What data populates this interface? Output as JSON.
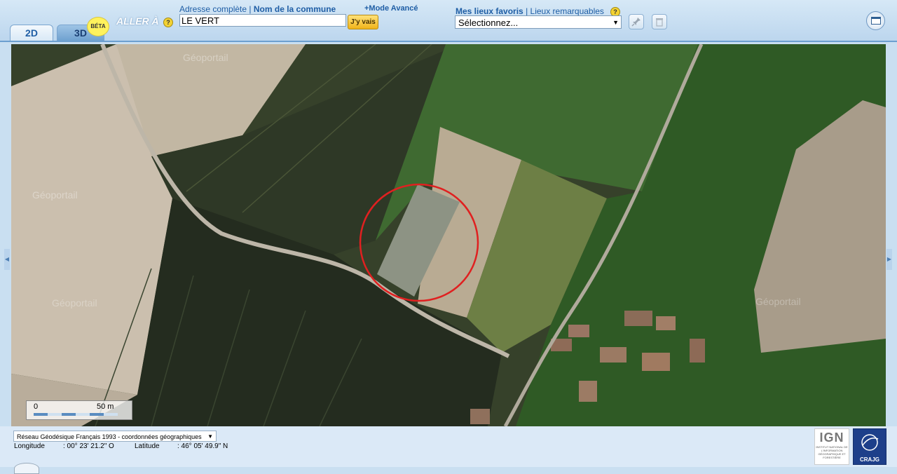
{
  "toolbar": {
    "tab_2d": "2D",
    "tab_3d": "3D",
    "beta_badge": "BÉTA",
    "goto_label": "ALLER À",
    "help_glyph": "?",
    "mode_full_address": "Adresse complète",
    "mode_separator": "|",
    "mode_commune": "Nom de la commune",
    "advanced_mode": "+Mode Avancé",
    "address_value": "LE VERT",
    "go_button": "J'y vais",
    "favorites_title": "Mes lieux favoris",
    "favorites_separator": "|",
    "remarkable_places": "Lieux remarquables",
    "favorites_select": "Sélectionnez...",
    "icons": {
      "help": "help-icon",
      "pin": "pin-icon",
      "delete": "trash-icon",
      "window": "window-icon",
      "dropdown": "dropdown-arrow-icon"
    }
  },
  "map": {
    "layer": "aerial photography",
    "watermark": "Géoportail",
    "highlight_color": "#e02020",
    "scale_zero": "0",
    "scale_distance": "50 m"
  },
  "footer": {
    "crs_select": "Réseau Géodésique Français 1993 - coordonnées géographiques",
    "longitude_label": "Longitude",
    "longitude_value": ": 00° 23' 21.2\" O",
    "latitude_label": "Latitude",
    "latitude_value": ": 46° 05' 49.9\" N",
    "ign_logo": "IGN",
    "ign_subtitle": "INSTITUT NATIONAL DE L'INFORMATION GÉOGRAPHIQUE ET FORESTIÈRE",
    "crajg_logo": "CRAJG"
  }
}
